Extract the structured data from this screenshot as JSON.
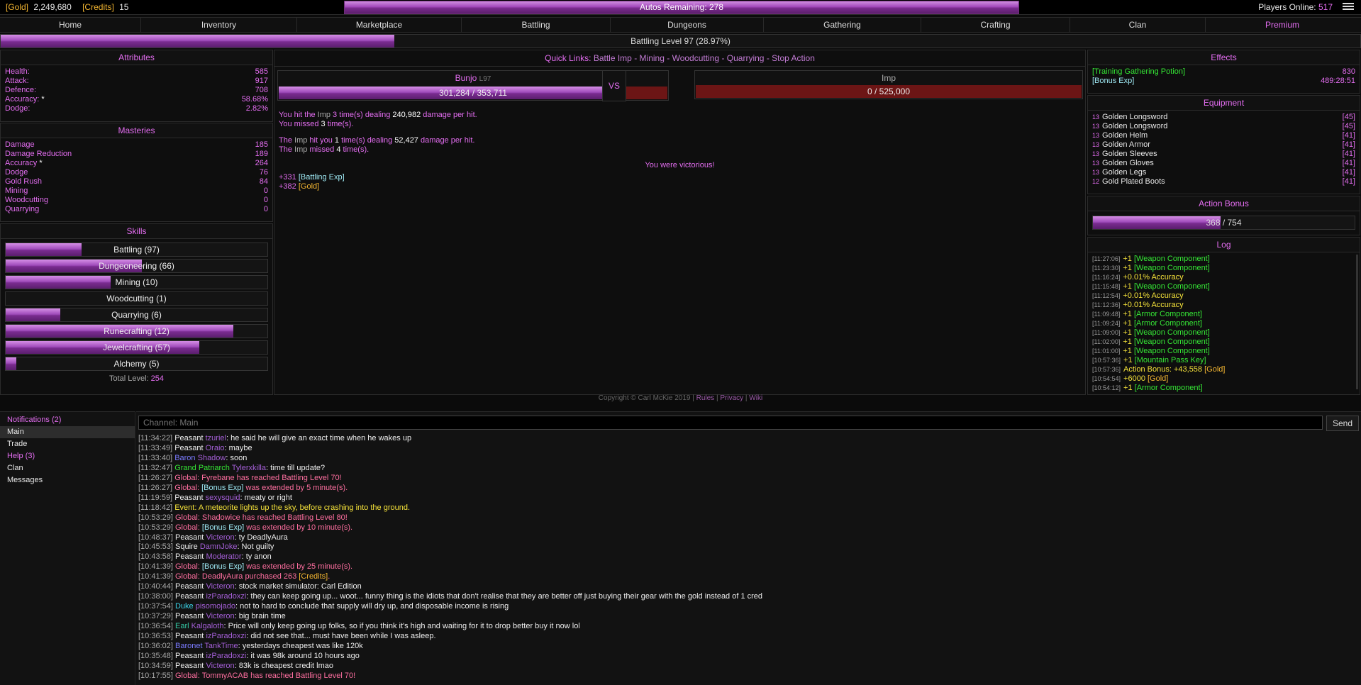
{
  "topbar": {
    "gold_label": "[Gold]",
    "gold_value": "2,249,680",
    "credits_label": "[Credits]",
    "credits_value": "15",
    "autos_remaining": "Autos Remaining: 278",
    "players_online_label": "Players Online:",
    "players_online_value": "517"
  },
  "nav": [
    "Home",
    "Inventory",
    "Marketplace",
    "Battling",
    "Dungeons",
    "Gathering",
    "Crafting",
    "Clan",
    "Premium"
  ],
  "level_bar": {
    "text": "Battling Level 97 (28.97%)",
    "progress": 0.2897
  },
  "attributes": {
    "title": "Attributes",
    "rows": [
      {
        "label": "Health:",
        "value": "585"
      },
      {
        "label": "Attack:",
        "value": "917"
      },
      {
        "label": "Defence:",
        "value": "708"
      },
      {
        "label": "Accuracy:",
        "value": "58.68%",
        "star": "*"
      },
      {
        "label": "Dodge:",
        "value": "2.82%"
      }
    ]
  },
  "masteries": {
    "title": "Masteries",
    "rows": [
      {
        "label": "Damage",
        "value": "185"
      },
      {
        "label": "Damage Reduction",
        "value": "189"
      },
      {
        "label": "Accuracy",
        "value": "264",
        "star": "*"
      },
      {
        "label": "Dodge",
        "value": "76"
      },
      {
        "label": "Gold Rush",
        "value": "84"
      },
      {
        "label": "Mining",
        "value": "0"
      },
      {
        "label": "Woodcutting",
        "value": "0"
      },
      {
        "label": "Quarrying",
        "value": "0"
      }
    ]
  },
  "skills": {
    "title": "Skills",
    "items": [
      {
        "label": "Battling (97)",
        "progress": 0.29
      },
      {
        "label": "Dungeoneering (66)",
        "progress": 0.52
      },
      {
        "label": "Mining (10)",
        "progress": 0.4
      },
      {
        "label": "Woodcutting (1)",
        "progress": 0.0
      },
      {
        "label": "Quarrying (6)",
        "progress": 0.21
      },
      {
        "label": "Runecrafting (12)",
        "progress": 0.87
      },
      {
        "label": "Jewelcrafting (57)",
        "progress": 0.74
      },
      {
        "label": "Alchemy (5)",
        "progress": 0.04
      }
    ],
    "total_label": "Total Level:",
    "total_value": "254"
  },
  "quick_links": {
    "label": "Quick Links:",
    "links": [
      "Battle Imp",
      "Mining",
      "Woodcutting",
      "Quarrying",
      "Stop Action"
    ],
    "sep": "-"
  },
  "battle": {
    "player_name": "Bunjo",
    "player_level": "L97",
    "player_hp": "301,284 / 353,711",
    "player_hp_frac": 0.8518,
    "vs": "VS",
    "enemy_name": "Imp",
    "enemy_hp": "0 / 525,000",
    "enemy_hp_frac": 0,
    "line1": [
      "You hit the ",
      "Imp",
      " 3 time(s) dealing ",
      "240,982",
      " damage per hit."
    ],
    "line2": [
      "You missed ",
      "3",
      " time(s)."
    ],
    "line3": [
      "The ",
      "Imp",
      " hit you ",
      "1",
      " time(s) dealing ",
      "52,427",
      " damage per hit."
    ],
    "line4": [
      "The ",
      "Imp",
      " missed ",
      "4",
      " time(s)."
    ],
    "victory": "You were victorious!",
    "reward1_amount": "+331",
    "reward1_item": "[Battling Exp]",
    "reward2_amount": "+382",
    "reward2_item": "[Gold]"
  },
  "effects": {
    "title": "Effects",
    "rows": [
      {
        "label": "[Training Gathering Potion]",
        "value": "830"
      },
      {
        "label": "[Bonus Exp]",
        "value": "489:28:51"
      }
    ]
  },
  "equipment": {
    "title": "Equipment",
    "rows": [
      {
        "q": "13",
        "name": "Golden Longsword",
        "lv": "[45]"
      },
      {
        "q": "13",
        "name": "Golden Longsword",
        "lv": "[45]"
      },
      {
        "q": "13",
        "name": "Golden Helm",
        "lv": "[41]"
      },
      {
        "q": "13",
        "name": "Golden Armor",
        "lv": "[41]"
      },
      {
        "q": "13",
        "name": "Golden Sleeves",
        "lv": "[41]"
      },
      {
        "q": "13",
        "name": "Golden Gloves",
        "lv": "[41]"
      },
      {
        "q": "13",
        "name": "Golden Legs",
        "lv": "[41]"
      },
      {
        "q": "12",
        "name": "Gold Plated Boots",
        "lv": "[41]"
      }
    ]
  },
  "action_bonus": {
    "title": "Action Bonus",
    "text": "368 / 754",
    "progress": 0.488
  },
  "log": {
    "title": "Log",
    "rows": [
      {
        "ts": "[11:27:06]",
        "pre": "+1 ",
        "item": "[Weapon Component]",
        "c": "green"
      },
      {
        "ts": "[11:23:30]",
        "pre": "+1 ",
        "item": "[Weapon Component]",
        "c": "green"
      },
      {
        "ts": "[11:16:24]",
        "pre": "+0.01% Accuracy",
        "item": "",
        "c": "yellow"
      },
      {
        "ts": "[11:15:48]",
        "pre": "+1 ",
        "item": "[Weapon Component]",
        "c": "green"
      },
      {
        "ts": "[11:12:54]",
        "pre": "+0.01% Accuracy",
        "item": "",
        "c": "yellow"
      },
      {
        "ts": "[11:12:36]",
        "pre": "+0.01% Accuracy",
        "item": "",
        "c": "yellow"
      },
      {
        "ts": "[11:09:48]",
        "pre": "+1 ",
        "item": "[Armor Component]",
        "c": "green"
      },
      {
        "ts": "[11:09:24]",
        "pre": "+1 ",
        "item": "[Armor Component]",
        "c": "green"
      },
      {
        "ts": "[11:09:00]",
        "pre": "+1 ",
        "item": "[Weapon Component]",
        "c": "green"
      },
      {
        "ts": "[11:02:00]",
        "pre": "+1 ",
        "item": "[Weapon Component]",
        "c": "green"
      },
      {
        "ts": "[11:01:00]",
        "pre": "+1 ",
        "item": "[Weapon Component]",
        "c": "green"
      },
      {
        "ts": "[10:57:36]",
        "pre": "+1 ",
        "item": "[Mountain Pass Key]",
        "c": "green"
      },
      {
        "ts": "[10:57:36]",
        "pre": "Action Bonus: +43,558 ",
        "item": "[Gold]",
        "c": "gold"
      },
      {
        "ts": "[10:54:54]",
        "pre": "+6000 ",
        "item": "[Gold]",
        "c": "gold"
      },
      {
        "ts": "[10:54:12]",
        "pre": "+1 ",
        "item": "[Armor Component]",
        "c": "green"
      }
    ]
  },
  "footer": {
    "copyright": "Copyright © Carl McKie 2019 |",
    "links": [
      "Rules",
      "Privacy",
      "Wiki"
    ]
  },
  "chat_side": [
    {
      "label": "Notifications (2)",
      "c": "pink"
    },
    {
      "label": "Main",
      "c": "white",
      "active": true
    },
    {
      "label": "Trade",
      "c": "white"
    },
    {
      "label": "Help (3)",
      "c": "pink"
    },
    {
      "label": "Clan",
      "c": "white"
    },
    {
      "label": "Messages",
      "c": "white"
    }
  ],
  "chat": {
    "placeholder": "Channel: Main",
    "send": "Send",
    "lines": [
      {
        "ts": "[11:34:22]",
        "rank": "Peasant",
        "rc": "rank",
        "user": "tzuriel",
        "msg": ": he said he will give an exact time when he wakes up"
      },
      {
        "ts": "[11:33:49]",
        "rank": "Peasant",
        "rc": "rank",
        "user": "Oraio",
        "msg": ": maybe"
      },
      {
        "ts": "[11:33:40]",
        "rank": "Baron",
        "rc": "baron",
        "user": "Shadow",
        "msg": ": soon"
      },
      {
        "ts": "[11:32:47]",
        "rank": "Grand Patriarch",
        "rc": "gp",
        "user": "Tylerxkilla",
        "msg": ": time till update?"
      },
      {
        "ts": "[11:26:27]",
        "global": "Global: Fyrebane has reached Battling Level 70!"
      },
      {
        "ts": "[11:26:27]",
        "global": "Global: ",
        "bonus": "[Bonus Exp]",
        "global2": " was extended by 5 minute(s)."
      },
      {
        "ts": "[11:19:59]",
        "rank": "Peasant",
        "rc": "rank",
        "user": "sexysquid",
        "msg": ": meaty or right"
      },
      {
        "ts": "[11:18:42]",
        "event": "Event: A meteorite lights up the sky, before crashing into the ground."
      },
      {
        "ts": "[10:53:29]",
        "global": "Global: Shadowice has reached Battling Level 80!"
      },
      {
        "ts": "[10:53:29]",
        "global": "Global: ",
        "bonus": "[Bonus Exp]",
        "global2": " was extended by 10 minute(s)."
      },
      {
        "ts": "[10:48:37]",
        "rank": "Peasant",
        "rc": "rank",
        "user": "Victeron",
        "msg": ": ty DeadlyAura"
      },
      {
        "ts": "[10:45:53]",
        "rank": "Squire",
        "rc": "rank",
        "user": "DamnJoke",
        "msg": ": Not guilty"
      },
      {
        "ts": "[10:43:58]",
        "rank": "Peasant",
        "rc": "rank",
        "user": "Moderator",
        "msg": ": ty anon"
      },
      {
        "ts": "[10:41:39]",
        "global": "Global: ",
        "bonus": "[Bonus Exp]",
        "global2": " was extended by 25 minute(s)."
      },
      {
        "ts": "[10:41:39]",
        "global": "Global: DeadlyAura purchased 263 ",
        "credits": "[Credits]",
        "global2": "."
      },
      {
        "ts": "[10:40:44]",
        "rank": "Peasant",
        "rc": "rank",
        "user": "Victeron",
        "msg": ": stock market simulator: Carl Edition"
      },
      {
        "ts": "[10:38:00]",
        "rank": "Peasant",
        "rc": "rank",
        "user": "izParadoxzi",
        "msg": ": they can keep going up... woot... funny thing is the idiots that don't realise that they are better off just buying their gear with the gold instead of 1 cred"
      },
      {
        "ts": "[10:37:54]",
        "rank": "Duke",
        "rc": "duke",
        "user": "pisomojado",
        "msg": ": not to hard to conclude that supply will dry up, and disposable income is rising"
      },
      {
        "ts": "[10:37:29]",
        "rank": "Peasant",
        "rc": "rank",
        "user": "Victeron",
        "msg": ": big brain time"
      },
      {
        "ts": "[10:36:54]",
        "rank": "Earl",
        "rc": "earl",
        "user": "Kalgaloth",
        "msg": ": Price will only keep going up folks, so if you think it's high and waiting for it to drop better buy it now lol"
      },
      {
        "ts": "[10:36:53]",
        "rank": "Peasant",
        "rc": "rank",
        "user": "izParadoxzi",
        "msg": ": did not see that... must have been while I was asleep."
      },
      {
        "ts": "[10:36:02]",
        "rank": "Baronet",
        "rc": "baronet",
        "user": "TankTime",
        "msg": ": yesterdays cheapest was like 120k"
      },
      {
        "ts": "[10:35:48]",
        "rank": "Peasant",
        "rc": "rank",
        "user": "izParadoxzi",
        "msg": ": it was 98k around 10 hours ago"
      },
      {
        "ts": "[10:34:59]",
        "rank": "Peasant",
        "rc": "rank",
        "user": "Victeron",
        "msg": ": 83k is cheapest credit lmao"
      },
      {
        "ts": "[10:17:55]",
        "global": "Global: TommyACAB has reached Battling Level 70!"
      }
    ]
  }
}
